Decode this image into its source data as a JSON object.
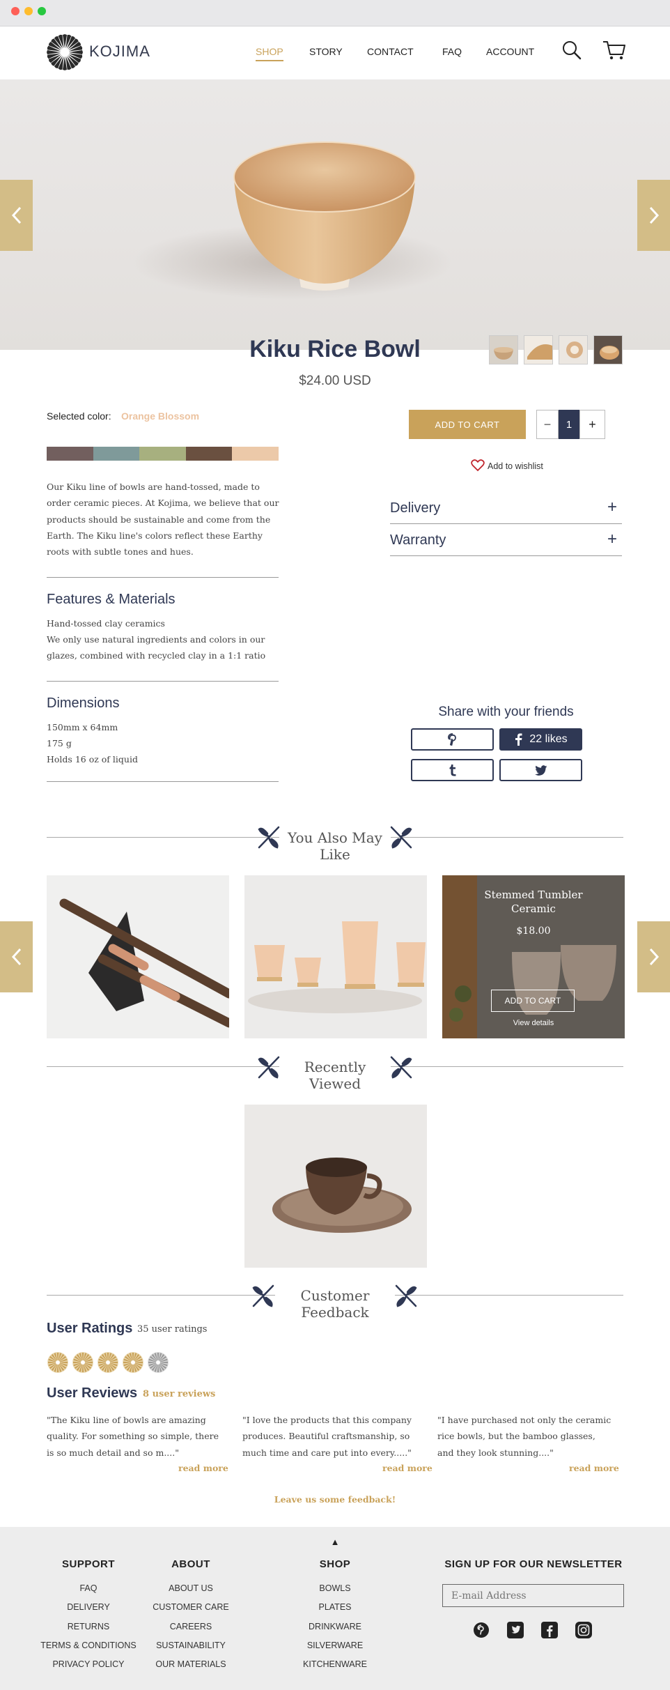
{
  "brand": {
    "name": "KOJIMA"
  },
  "nav": [
    {
      "label": "SHOP",
      "active": true
    },
    {
      "label": "STORY"
    },
    {
      "label": "CONTACT"
    },
    {
      "label": "FAQ"
    },
    {
      "label": "ACCOUNT"
    }
  ],
  "icons": {
    "search": "search-icon",
    "cart": "cart-icon",
    "prev": "chevron-left-icon",
    "next": "chevron-right-icon",
    "heart": "heart-icon"
  },
  "product": {
    "title": "Kiku Rice Bowl",
    "price": "$24.00 USD",
    "color_label": "Selected color:",
    "color_value": "Orange Blossom",
    "swatches": [
      "#725f5e",
      "#7f9a9a",
      "#a7b07f",
      "#6a5040",
      "#ecc9a9"
    ],
    "description": "Our Kiku line of bowls are hand-tossed, made to order ceramic pieces. At Kojima, we believe that our products should be sustainable and come from the Earth. The Kiku line's colors reflect these Earthy roots with subtle tones and hues.",
    "add_to_cart": "ADD TO CART",
    "quantity": "1",
    "minus": "−",
    "plus": "+",
    "wishlist": "Add to wishlist"
  },
  "features": {
    "title": "Features & Materials",
    "lines": [
      "Hand-tossed clay ceramics",
      "We only use natural ingredients and colors in our glazes, combined with recycled clay in a 1:1 ratio"
    ]
  },
  "dimensions": {
    "title": "Dimensions",
    "lines": [
      "150mm x 64mm",
      "175 g",
      "Holds 16 oz of liquid"
    ]
  },
  "accordion": [
    {
      "label": "Delivery",
      "toggle": "+"
    },
    {
      "label": "Warranty",
      "toggle": "+"
    }
  ],
  "share": {
    "title": "Share with your friends",
    "likes": "22 likes"
  },
  "sections": {
    "also_like": "You Also May Like",
    "recent": "Recently Viewed",
    "feedback": "Customer Feedback"
  },
  "hover_card": {
    "name": "Stemmed Tumbler Ceramic",
    "price": "$18.00",
    "button": "ADD TO CART",
    "details": "View details"
  },
  "ratings": {
    "title": "User Ratings",
    "count": "35 user ratings",
    "filled": 4,
    "total": 5
  },
  "reviews": {
    "title": "User Reviews",
    "count": "8 user reviews",
    "items": [
      {
        "text": "\"The Kiku line of bowls are amazing quality. For something so simple, there is so much detail and so m....\"",
        "more": "read more"
      },
      {
        "text": "\"I love the products that this company produces. Beautiful craftsmanship, so much time and care put into every.....\"",
        "more": "read more"
      },
      {
        "text": "\"I have purchased not only the ceramic rice bowls, but the bamboo glasses, and they look stunning....\"",
        "more": "read more"
      }
    ],
    "leave": "Leave us some feedback!"
  },
  "footer": {
    "up": "▲",
    "columns": [
      {
        "title": "SUPPORT",
        "links": [
          "FAQ",
          "DELIVERY",
          "RETURNS",
          "TERMS & CONDITIONS",
          "PRIVACY POLICY"
        ]
      },
      {
        "title": "ABOUT",
        "links": [
          "ABOUT US",
          "CUSTOMER CARE",
          "CAREERS",
          "SUSTAINABILITY",
          "OUR MATERIALS"
        ]
      },
      {
        "title": "SHOP",
        "links": [
          "BOWLS",
          "PLATES",
          "DRINKWARE",
          "SILVERWARE",
          "KITCHENWARE"
        ]
      }
    ],
    "newsletter": {
      "title": "SIGN UP FOR OUR NEWSLETTER",
      "placeholder": "E-mail Address"
    },
    "social": [
      "pinterest-icon",
      "twitter-icon",
      "facebook-icon",
      "instagram-icon"
    ]
  },
  "colors": {
    "accent": "#c9a25a",
    "navy": "#2f3854",
    "arrow": "#d3bd87"
  }
}
